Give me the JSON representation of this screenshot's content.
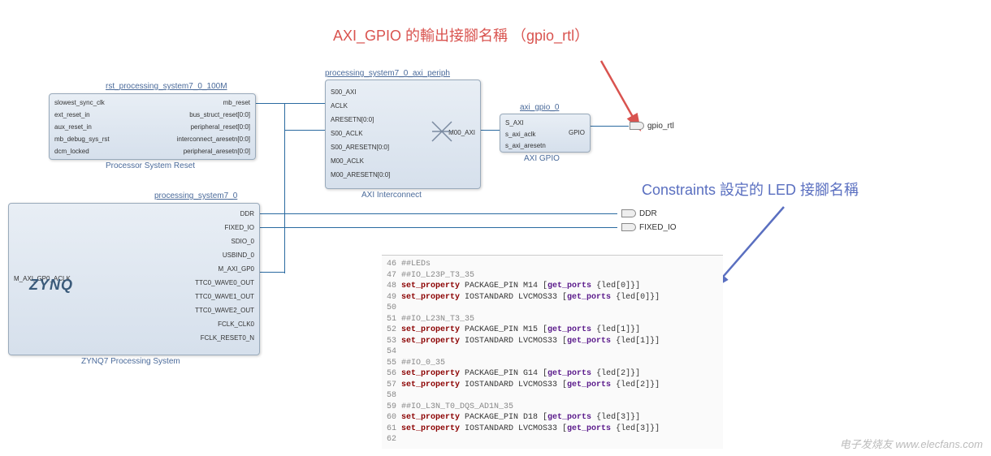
{
  "annotations": {
    "red": "AXI_GPIO  的輸出接腳名稱 （gpio_rtl）",
    "blue": "Constraints  設定的  LED  接腳名稱"
  },
  "blocks": {
    "rst": {
      "title": "rst_processing_system7_0_100M",
      "caption": "Processor System Reset",
      "ports_left": [
        "slowest_sync_clk",
        "ext_reset_in",
        "aux_reset_in",
        "mb_debug_sys_rst",
        "dcm_locked"
      ],
      "ports_right": [
        "mb_reset",
        "bus_struct_reset[0:0]",
        "peripheral_reset[0:0]",
        "interconnect_aresetn[0:0]",
        "peripheral_aresetn[0:0]"
      ]
    },
    "zynq": {
      "title": "processing_system7_0",
      "caption": "ZYNQ7 Processing System",
      "logo": "ZYNQ",
      "ports_left": [
        "M_AXI_GP0_ACLK"
      ],
      "ports_right": [
        "DDR",
        "FIXED_IO",
        "SDIO_0",
        "USBIND_0",
        "M_AXI_GP0",
        "TTC0_WAVE0_OUT",
        "TTC0_WAVE1_OUT",
        "TTC0_WAVE2_OUT",
        "FCLK_CLK0",
        "FCLK_RESET0_N"
      ]
    },
    "interconnect": {
      "title": "processing_system7_0_axi_periph",
      "caption": "AXI Interconnect",
      "ports_left": [
        "S00_AXI",
        "ACLK",
        "ARESETN[0:0]",
        "S00_ACLK",
        "S00_ARESETN[0:0]",
        "M00_ACLK",
        "M00_ARESETN[0:0]"
      ],
      "ports_right": [
        "M00_AXI"
      ]
    },
    "gpio": {
      "title": "axi_gpio_0",
      "caption": "AXI GPIO",
      "ports_left": [
        "S_AXI",
        "s_axi_aclk",
        "s_axi_aresetn"
      ],
      "ports_right": [
        "GPIO"
      ]
    }
  },
  "external_ports": {
    "gpio_rtl": "gpio_rtl",
    "ddr": "DDR",
    "fixed_io": "FIXED_IO"
  },
  "code": {
    "lines": [
      {
        "num": "46",
        "type": "comment",
        "text": "##LEDs"
      },
      {
        "num": "47",
        "type": "comment",
        "text": "##IO_L23P_T3_35"
      },
      {
        "num": "48",
        "type": "cmd",
        "parts": [
          "set_property",
          " PACKAGE_PIN M14 [",
          "get_ports",
          " {led[0]}]"
        ]
      },
      {
        "num": "49",
        "type": "cmd",
        "parts": [
          "set_property",
          " IOSTANDARD LVCMOS33 [",
          "get_ports",
          " {led[0]}]"
        ]
      },
      {
        "num": "50",
        "type": "blank",
        "text": ""
      },
      {
        "num": "51",
        "type": "comment",
        "text": "##IO_L23N_T3_35"
      },
      {
        "num": "52",
        "type": "cmd",
        "parts": [
          "set_property",
          " PACKAGE_PIN M15 [",
          "get_ports",
          " {led[1]}]"
        ]
      },
      {
        "num": "53",
        "type": "cmd",
        "parts": [
          "set_property",
          " IOSTANDARD LVCMOS33 [",
          "get_ports",
          " {led[1]}]"
        ]
      },
      {
        "num": "54",
        "type": "blank",
        "text": ""
      },
      {
        "num": "55",
        "type": "comment",
        "text": "##IO_0_35"
      },
      {
        "num": "56",
        "type": "cmd",
        "parts": [
          "set_property",
          " PACKAGE_PIN G14 [",
          "get_ports",
          " {led[2]}]"
        ]
      },
      {
        "num": "57",
        "type": "cmd",
        "parts": [
          "set_property",
          " IOSTANDARD LVCMOS33 [",
          "get_ports",
          " {led[2]}]"
        ]
      },
      {
        "num": "58",
        "type": "blank",
        "text": ""
      },
      {
        "num": "59",
        "type": "comment",
        "text": "##IO_L3N_T0_DQS_AD1N_35"
      },
      {
        "num": "60",
        "type": "cmd",
        "parts": [
          "set_property",
          " PACKAGE_PIN D18 [",
          "get_ports",
          " {led[3]}]"
        ]
      },
      {
        "num": "61",
        "type": "cmd",
        "parts": [
          "set_property",
          " IOSTANDARD LVCMOS33 [",
          "get_ports",
          " {led[3]}]"
        ]
      },
      {
        "num": "62",
        "type": "blank",
        "text": ""
      }
    ]
  },
  "watermark": "电子发烧友  www.elecfans.com"
}
